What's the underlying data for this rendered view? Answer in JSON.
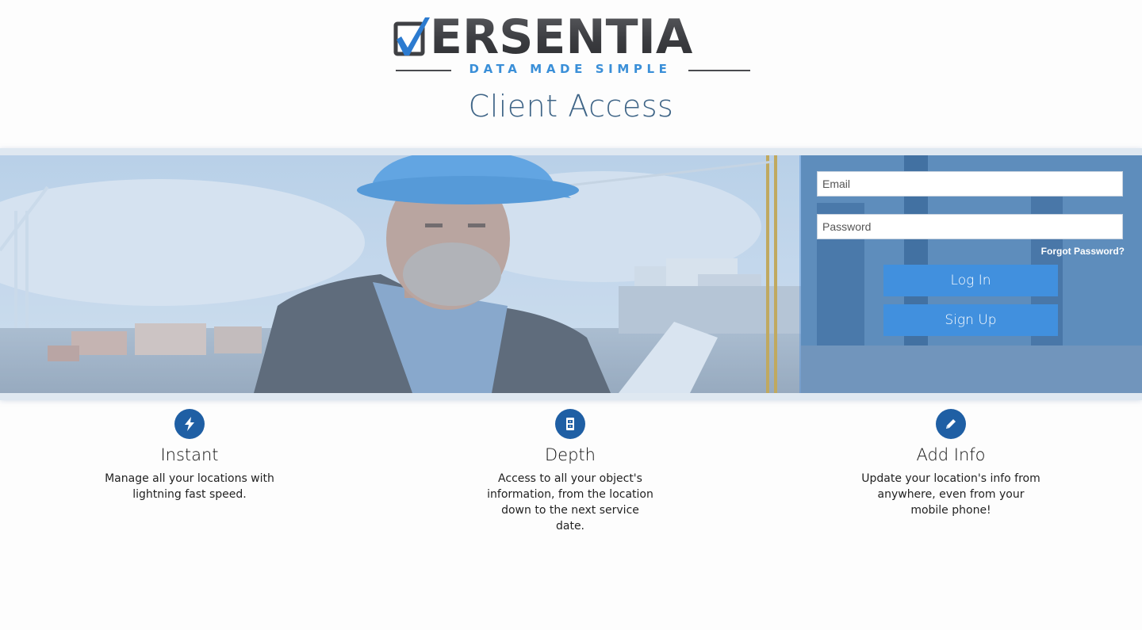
{
  "brand": {
    "name": "VERSENTIA",
    "word_after_checkmark": "ERSENTIA",
    "tagline": "DATA MADE SIMPLE",
    "colors": {
      "dark": "#444447",
      "accent": "#3a8fd8"
    }
  },
  "page_title": "Client Access",
  "login": {
    "email_placeholder": "Email",
    "email_value": "",
    "password_placeholder": "Password",
    "password_value": "",
    "forgot_label": "Forgot Password?",
    "login_label": "Log In",
    "signup_label": "Sign Up",
    "button_color": "#4190de"
  },
  "hero": {
    "image": "construction-worker-photo"
  },
  "features": [
    {
      "icon": "lightning-icon",
      "title": "Instant",
      "description": "Manage all your locations with lightning fast speed."
    },
    {
      "icon": "file-cabinet-icon",
      "title": "Depth",
      "description": "Access to all your object's information, from the location down to the next service date."
    },
    {
      "icon": "pencil-icon",
      "title": "Add Info",
      "description": "Update your location's info from anywhere, even from your mobile phone!"
    }
  ]
}
